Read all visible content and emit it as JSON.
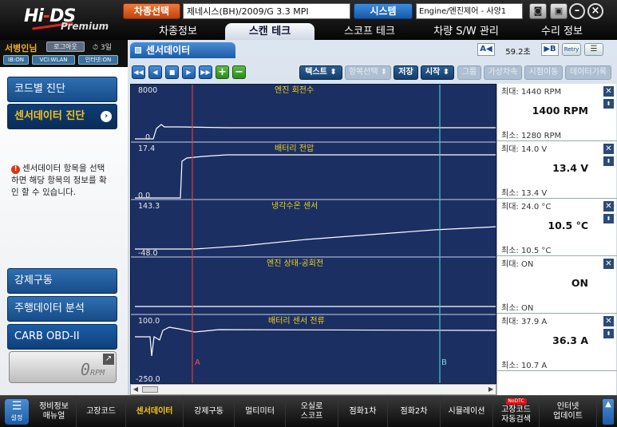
{
  "header": {
    "vehicle_btn": "차종선택",
    "vehicle_value": "제네시스(BH)/2009/G 3.3 MPI",
    "system_btn": "시스템",
    "system_value": "Engine/엔진제어 - 사양1",
    "camera_icon": "camera-icon",
    "window_icon": "window-icon",
    "minimize": "–",
    "close": "×"
  },
  "main_tabs": [
    {
      "label": "차종정보"
    },
    {
      "label": "스캔 테크"
    },
    {
      "label": "스코프 테크"
    },
    {
      "label": "차량 S/W 관리"
    },
    {
      "label": "수리 정보"
    }
  ],
  "userbar": {
    "user": "서병인님",
    "logout": "로그아웃",
    "clock": "3일",
    "pills": [
      "IB:ON",
      "VCI:WLAN",
      "인터넷:ON"
    ]
  },
  "left_menu": {
    "code_diag": "코드별 진단",
    "sensor_diag": "센서데이터 진단",
    "hint": "센서데이터 항목을 선택하면 해당 항목의 정보를 확인 할 수 있습니다.",
    "forced_drive": "강제구동",
    "drive_analysis": "주행데이터 분석",
    "carb": "CARB OBD-II",
    "rpm_digit": "0",
    "rpm_unit": "RPM"
  },
  "content": {
    "sensor_tab": "센서데이터",
    "page_prev": "A◀",
    "page_text": "59.2초",
    "page_next": "▶B",
    "retry": "Retry",
    "toolbar": {
      "text": "텍스트 ⬍",
      "select": "항목선택 ⬍",
      "save": "저장",
      "start": "시작 ⬍",
      "group": "그룹",
      "virtual": "가상차속",
      "timeshift": "시점이동",
      "record": "데이터기록"
    }
  },
  "sensors": [
    {
      "name": "엔진 회전수",
      "axis_max": "8000",
      "axis_min": "0",
      "max": "최대: 1440 RPM",
      "current": "1400 RPM",
      "min": "최소: 1280 RPM"
    },
    {
      "name": "배터리 전압",
      "axis_max": "17.4",
      "axis_min": "0.0",
      "max": "최대: 14.0 V",
      "current": "13.4 V",
      "min": "최소: 13.4 V"
    },
    {
      "name": "냉각수온 센서",
      "axis_max": "143.3",
      "axis_min": "-48.0",
      "max": "최대: 24.0 °C",
      "current": "10.5 °C",
      "min": "최소: 10.5 °C"
    },
    {
      "name": "엔진 상태-공회전",
      "axis_max": "",
      "axis_min": "",
      "max": "최대: ON",
      "current": "ON",
      "min": "최소: ON"
    },
    {
      "name": "배터리 센서 전류",
      "axis_max": "100.0",
      "axis_min": "-250.0",
      "max": "최대: 37.9 A",
      "current": "36.3 A",
      "min": "최소: 10.7 A"
    }
  ],
  "cursors": {
    "a": "A",
    "b": "B"
  },
  "bottom_bar": [
    {
      "label": "정비정보\n매뉴얼"
    },
    {
      "label": "고장코드"
    },
    {
      "label": "센서데이터"
    },
    {
      "label": "강제구동"
    },
    {
      "label": "멀티미터"
    },
    {
      "label": "오실로\n스코프"
    },
    {
      "label": "점화1차"
    },
    {
      "label": "점화2차"
    },
    {
      "label": "시뮬레이션"
    },
    {
      "label": "고장코드\n자동검색",
      "badge": "NoDTC"
    },
    {
      "label": "인터넷\n업데이트"
    }
  ],
  "settings_label": "설정",
  "colors": {
    "accent_orange": "#d9561a",
    "accent_blue": "#1d5ca6",
    "graph_bg": "#1b2f63",
    "label_yellow": "#f0d21f",
    "cursor_a": "#e23a3a",
    "cursor_b": "#48c7cf"
  }
}
